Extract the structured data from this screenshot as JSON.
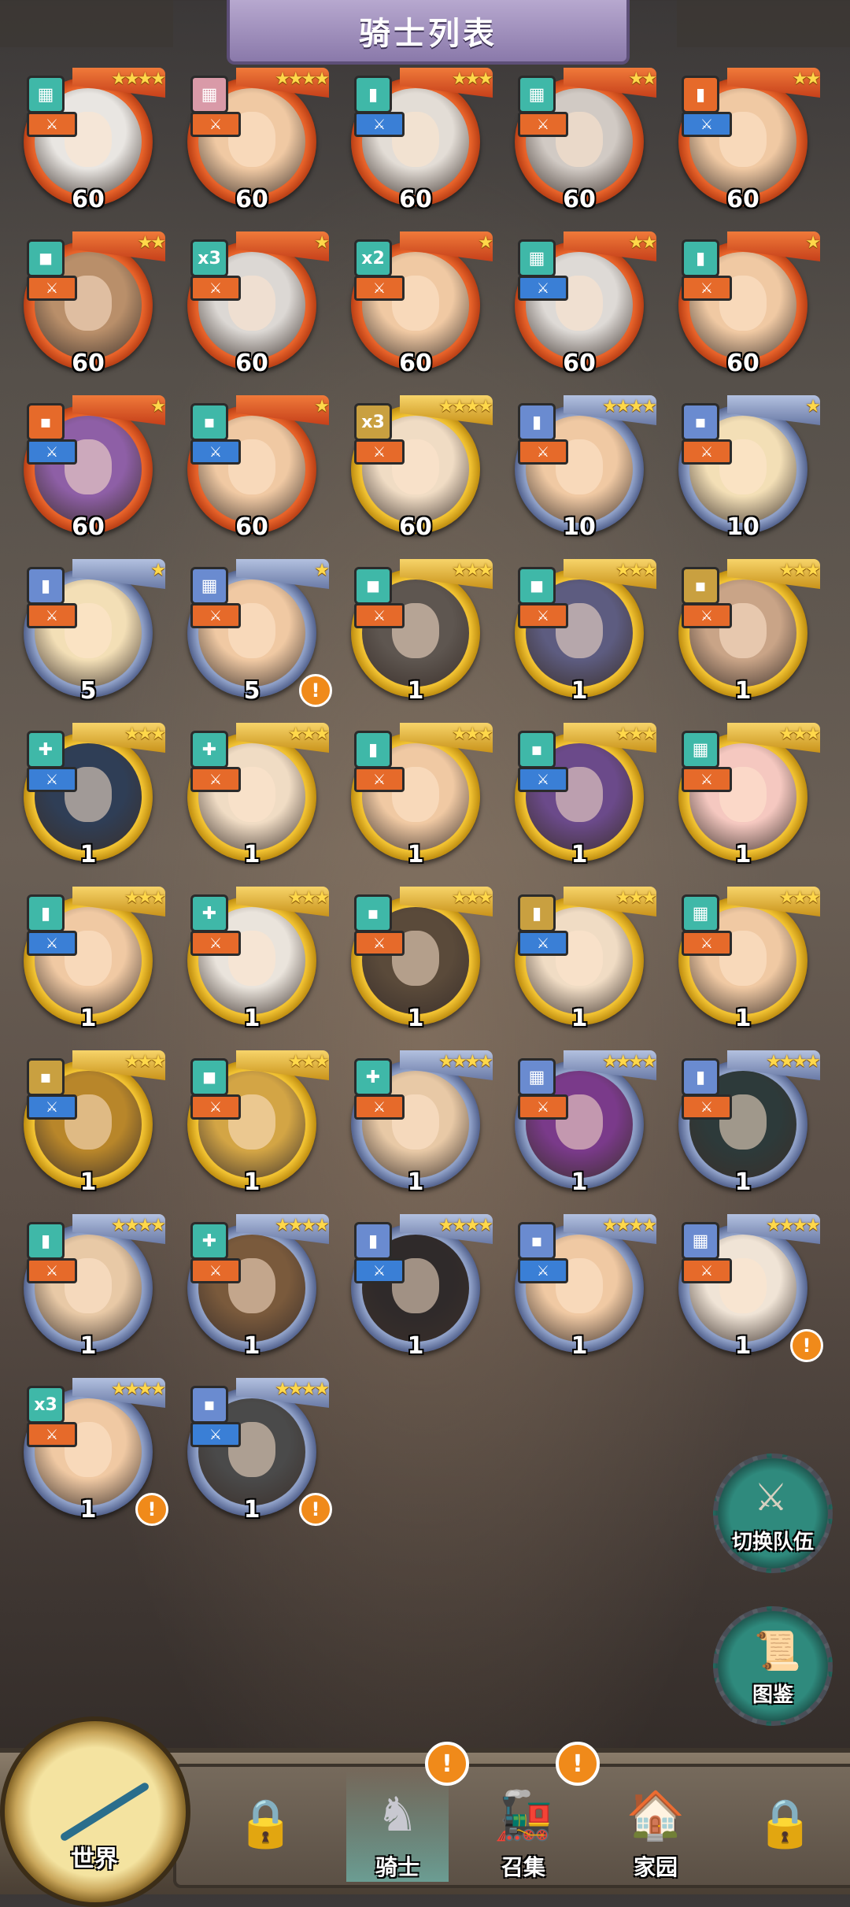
{
  "header": {
    "title": "骑士列表"
  },
  "colors": {
    "red": "#e8632a",
    "gold": "#f1c232",
    "blue": "#8fa0c7",
    "accent_alert": "#f08a1a",
    "teal": "#2f8a7d"
  },
  "knights": [
    {
      "frame": "red",
      "stars": "★★★★",
      "level": "60",
      "class_icon": "grid-icon",
      "class_color": "#3fb8a8",
      "type_color": "#e66a2a",
      "alert": false,
      "skin": "#e9e6e2"
    },
    {
      "frame": "red",
      "stars": "★★★★",
      "level": "60",
      "class_icon": "grid-icon",
      "class_color": "#d99aa8",
      "type_color": "#e66a2a",
      "alert": false,
      "skin": "#f0c9a3"
    },
    {
      "frame": "red",
      "stars": "★★★",
      "level": "60",
      "class_icon": "bar-icon",
      "class_color": "#3fb8a8",
      "type_color": "#3a7fd6",
      "alert": false,
      "skin": "#e3ddd6"
    },
    {
      "frame": "red",
      "stars": "★★",
      "level": "60",
      "class_icon": "grid-icon",
      "class_color": "#3fb8a8",
      "type_color": "#e66a2a",
      "alert": false,
      "skin": "#d1cac4"
    },
    {
      "frame": "red",
      "stars": "★★",
      "level": "60",
      "class_icon": "bar-icon",
      "class_color": "#e66a2a",
      "type_color": "#3a7fd6",
      "alert": false,
      "skin": "#f0c9a3"
    },
    {
      "frame": "red",
      "stars": "★★",
      "level": "60",
      "class_icon": "box-icon",
      "class_color": "#3fb8a8",
      "type_color": "#e66a2a",
      "alert": false,
      "skin": "#b98f6a"
    },
    {
      "frame": "red",
      "stars": "★",
      "level": "60",
      "class_icon": "x3-icon",
      "class_color": "#3fb8a8",
      "type_color": "#e66a2a",
      "alert": false,
      "skin": "#dcd8d4"
    },
    {
      "frame": "red",
      "stars": "★",
      "level": "60",
      "class_icon": "x2-icon",
      "class_color": "#3fb8a8",
      "type_color": "#e66a2a",
      "alert": false,
      "skin": "#f0c9a3"
    },
    {
      "frame": "red",
      "stars": "★★",
      "level": "60",
      "class_icon": "grid-icon",
      "class_color": "#3fb8a8",
      "type_color": "#3a7fd6",
      "alert": false,
      "skin": "#dedad6"
    },
    {
      "frame": "red",
      "stars": "★",
      "level": "60",
      "class_icon": "bar-icon",
      "class_color": "#3fb8a8",
      "type_color": "#e66a2a",
      "alert": false,
      "skin": "#f0c9a3"
    },
    {
      "frame": "red",
      "stars": "★",
      "level": "60",
      "class_icon": "dot-icon",
      "class_color": "#e66a2a",
      "type_color": "#3a7fd6",
      "alert": false,
      "skin": "#8e5fa6"
    },
    {
      "frame": "red",
      "stars": "★",
      "level": "60",
      "class_icon": "dot-icon",
      "class_color": "#3fb8a8",
      "type_color": "#3a7fd6",
      "alert": false,
      "skin": "#f0c9a3"
    },
    {
      "frame": "gold",
      "stars": "★★★★",
      "level": "60",
      "class_icon": "x3-icon",
      "class_color": "#c9a040",
      "type_color": "#e66a2a",
      "alert": false,
      "skin": "#f0dcc4"
    },
    {
      "frame": "blue",
      "stars": "★★★★",
      "level": "10",
      "class_icon": "bar-icon",
      "class_color": "#6a8bd0",
      "type_color": "#e66a2a",
      "alert": false,
      "skin": "#f0c9a3"
    },
    {
      "frame": "blue",
      "stars": "★",
      "level": "10",
      "class_icon": "dot-icon",
      "class_color": "#6a8bd0",
      "type_color": "#e66a2a",
      "alert": false,
      "skin": "#f3dfb6"
    },
    {
      "frame": "blue",
      "stars": "★",
      "level": "5",
      "class_icon": "bar-icon",
      "class_color": "#6a8bd0",
      "type_color": "#e66a2a",
      "alert": false,
      "skin": "#f3dfb6"
    },
    {
      "frame": "blue",
      "stars": "★",
      "level": "5",
      "class_icon": "grid-icon",
      "class_color": "#6a8bd0",
      "type_color": "#e66a2a",
      "alert": true,
      "skin": "#f0c9a3"
    },
    {
      "frame": "gold",
      "stars": "★★★",
      "level": "1",
      "class_icon": "box-icon",
      "class_color": "#3fb8a8",
      "type_color": "#e66a2a",
      "alert": false,
      "skin": "#5e5650"
    },
    {
      "frame": "gold",
      "stars": "★★★",
      "level": "1",
      "class_icon": "box-icon",
      "class_color": "#3fb8a8",
      "type_color": "#e66a2a",
      "alert": false,
      "skin": "#5d5c80"
    },
    {
      "frame": "gold",
      "stars": "★★★",
      "level": "1",
      "class_icon": "dot-icon",
      "class_color": "#c9a040",
      "type_color": "#e66a2a",
      "alert": false,
      "skin": "#c9a487"
    },
    {
      "frame": "gold",
      "stars": "★★★",
      "level": "1",
      "class_icon": "plus-icon",
      "class_color": "#3fb8a8",
      "type_color": "#3a7fd6",
      "alert": false,
      "skin": "#2f3e56"
    },
    {
      "frame": "gold",
      "stars": "★★★",
      "level": "1",
      "class_icon": "plus-icon",
      "class_color": "#3fb8a8",
      "type_color": "#e66a2a",
      "alert": false,
      "skin": "#f0dcc4"
    },
    {
      "frame": "gold",
      "stars": "★★★",
      "level": "1",
      "class_icon": "bar-icon",
      "class_color": "#3fb8a8",
      "type_color": "#e66a2a",
      "alert": false,
      "skin": "#f0c9a3"
    },
    {
      "frame": "gold",
      "stars": "★★★",
      "level": "1",
      "class_icon": "dot-icon",
      "class_color": "#3fb8a8",
      "type_color": "#3a7fd6",
      "alert": false,
      "skin": "#6b4a8a"
    },
    {
      "frame": "gold",
      "stars": "★★★",
      "level": "1",
      "class_icon": "grid-icon",
      "class_color": "#3fb8a8",
      "type_color": "#e66a2a",
      "alert": false,
      "skin": "#f5c8c0"
    },
    {
      "frame": "gold",
      "stars": "★★★",
      "level": "1",
      "class_icon": "bar-icon",
      "class_color": "#3fb8a8",
      "type_color": "#3a7fd6",
      "alert": false,
      "skin": "#f0c9a3"
    },
    {
      "frame": "gold",
      "stars": "★★★",
      "level": "1",
      "class_icon": "plus-icon",
      "class_color": "#3fb8a8",
      "type_color": "#e66a2a",
      "alert": false,
      "skin": "#eae4dc"
    },
    {
      "frame": "gold",
      "stars": "★★★",
      "level": "1",
      "class_icon": "dot-icon",
      "class_color": "#3fb8a8",
      "type_color": "#e66a2a",
      "alert": false,
      "skin": "#5a4a3a"
    },
    {
      "frame": "gold",
      "stars": "★★★",
      "level": "1",
      "class_icon": "bar-icon",
      "class_color": "#c9a040",
      "type_color": "#3a7fd6",
      "alert": false,
      "skin": "#f0dcc4"
    },
    {
      "frame": "gold",
      "stars": "★★★",
      "level": "1",
      "class_icon": "grid-icon",
      "class_color": "#3fb8a8",
      "type_color": "#e66a2a",
      "alert": false,
      "skin": "#f0c9a3"
    },
    {
      "frame": "gold",
      "stars": "★★★",
      "level": "1",
      "class_icon": "dot-icon",
      "class_color": "#c9a040",
      "type_color": "#3a7fd6",
      "alert": false,
      "skin": "#b8862a"
    },
    {
      "frame": "gold",
      "stars": "★★★",
      "level": "1",
      "class_icon": "box-icon",
      "class_color": "#3fb8a8",
      "type_color": "#e66a2a",
      "alert": false,
      "skin": "#d3a545"
    },
    {
      "frame": "blue",
      "stars": "★★★★",
      "level": "1",
      "class_icon": "plus-icon",
      "class_color": "#3fb8a8",
      "type_color": "#e66a2a",
      "alert": false,
      "skin": "#e8c9a6"
    },
    {
      "frame": "blue",
      "stars": "★★★★",
      "level": "1",
      "class_icon": "grid-icon",
      "class_color": "#6a8bd0",
      "type_color": "#e66a2a",
      "alert": false,
      "skin": "#7a3a8a"
    },
    {
      "frame": "blue",
      "stars": "★★★★",
      "level": "1",
      "class_icon": "bar-icon",
      "class_color": "#6a8bd0",
      "type_color": "#e66a2a",
      "alert": false,
      "skin": "#2d3a3a"
    },
    {
      "frame": "blue",
      "stars": "★★★★",
      "level": "1",
      "class_icon": "bar-icon",
      "class_color": "#3fb8a8",
      "type_color": "#e66a2a",
      "alert": false,
      "skin": "#e8c9a6"
    },
    {
      "frame": "blue",
      "stars": "★★★★",
      "level": "1",
      "class_icon": "plus-icon",
      "class_color": "#3fb8a8",
      "type_color": "#e66a2a",
      "alert": false,
      "skin": "#7a5a3c"
    },
    {
      "frame": "blue",
      "stars": "★★★★",
      "level": "1",
      "class_icon": "bar-icon",
      "class_color": "#6a8bd0",
      "type_color": "#3a7fd6",
      "alert": false,
      "skin": "#2f2a2a"
    },
    {
      "frame": "blue",
      "stars": "★★★★",
      "level": "1",
      "class_icon": "dot-icon",
      "class_color": "#6a8bd0",
      "type_color": "#3a7fd6",
      "alert": false,
      "skin": "#f0c9a3"
    },
    {
      "frame": "blue",
      "stars": "★★★★",
      "level": "1",
      "class_icon": "grid-icon",
      "class_color": "#6a8bd0",
      "type_color": "#e66a2a",
      "alert": true,
      "skin": "#f0e4d6"
    },
    {
      "frame": "blue",
      "stars": "★★★★",
      "level": "1",
      "class_icon": "x3-icon",
      "class_color": "#3fb8a8",
      "type_color": "#e66a2a",
      "alert": true,
      "skin": "#f0c9a3"
    },
    {
      "frame": "blue",
      "stars": "★★★★",
      "level": "1",
      "class_icon": "dot-icon",
      "class_color": "#6a8bd0",
      "type_color": "#3a7fd6",
      "alert": true,
      "skin": "#4a4a4a"
    }
  ],
  "side_buttons": {
    "switch_team": {
      "label": "切换队伍",
      "icon": "sword-shield-icon"
    },
    "codex": {
      "label": "图鉴",
      "icon": "scroll-icon"
    }
  },
  "nav": {
    "world": {
      "label": "世界",
      "icon": "compass-icon"
    },
    "knights": {
      "label": "骑士",
      "icon": "knight-icon",
      "alert": "!"
    },
    "summon": {
      "label": "召集",
      "icon": "train-icon",
      "alert": "!"
    },
    "home": {
      "label": "家园",
      "icon": "house-icon"
    }
  },
  "alert_glyph": "!"
}
